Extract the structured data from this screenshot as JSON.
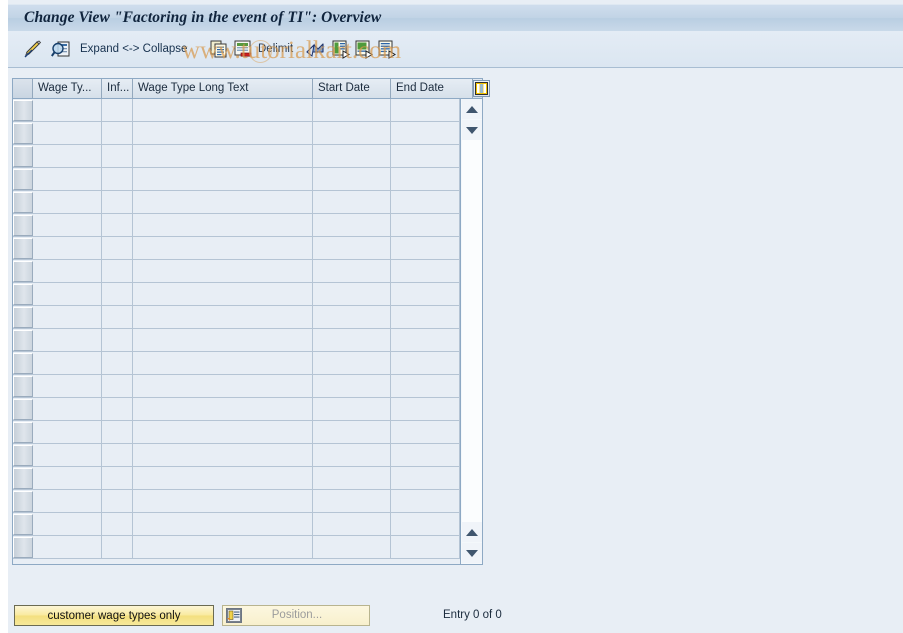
{
  "window": {
    "title": "Change View \"Factoring in the event of TI\": Overview"
  },
  "toolbar": {
    "items": [
      {
        "name": "change-entry-icon",
        "label": "",
        "icon": "pencil-paper-icon"
      },
      {
        "name": "display-entry-icon",
        "label": "",
        "icon": "magnifier-document-icon"
      },
      {
        "name": "expand-collapse",
        "label": "Expand <-> Collapse",
        "icon": ""
      },
      {
        "name": "copy-as-icon",
        "label": "",
        "icon": "copy-documents-icon"
      },
      {
        "name": "delete-icon",
        "label": "",
        "icon": "delete-document-icon"
      },
      {
        "name": "delimit-button",
        "label": "Delimit",
        "icon": ""
      },
      {
        "name": "undo-icon",
        "label": "",
        "icon": "undo-arrow-icon"
      },
      {
        "name": "select-block-icon",
        "label": "",
        "icon": "list-arrow-icon-1"
      },
      {
        "name": "select-all-icon",
        "label": "",
        "icon": "list-arrow-icon-2"
      },
      {
        "name": "deselect-all-icon",
        "label": "",
        "icon": "list-arrow-icon-3"
      }
    ]
  },
  "watermark": {
    "text": "www.tutorialkart.com",
    "color": "#d89a4e"
  },
  "table": {
    "columns": [
      {
        "key": "select",
        "label": ""
      },
      {
        "key": "wagetype",
        "label": "Wage Ty..."
      },
      {
        "key": "infotype",
        "label": "Inf..."
      },
      {
        "key": "longtext",
        "label": "Wage Type Long Text"
      },
      {
        "key": "start",
        "label": "Start Date"
      },
      {
        "key": "end",
        "label": "End Date"
      }
    ],
    "rows": [],
    "empty_row_count": 20,
    "config_icon": "column-config-icon"
  },
  "scrollbar": {
    "top_up_icon": "scroll-up-icon",
    "top_down_icon": "scroll-down-icon",
    "bottom_up_icon": "scroll-up-icon",
    "bottom_down_icon": "scroll-down-icon"
  },
  "footer": {
    "customer_button": "customer wage types only",
    "position_button": "Position...",
    "position_icon": "position-list-icon",
    "entry_status": "Entry 0 of 0"
  }
}
